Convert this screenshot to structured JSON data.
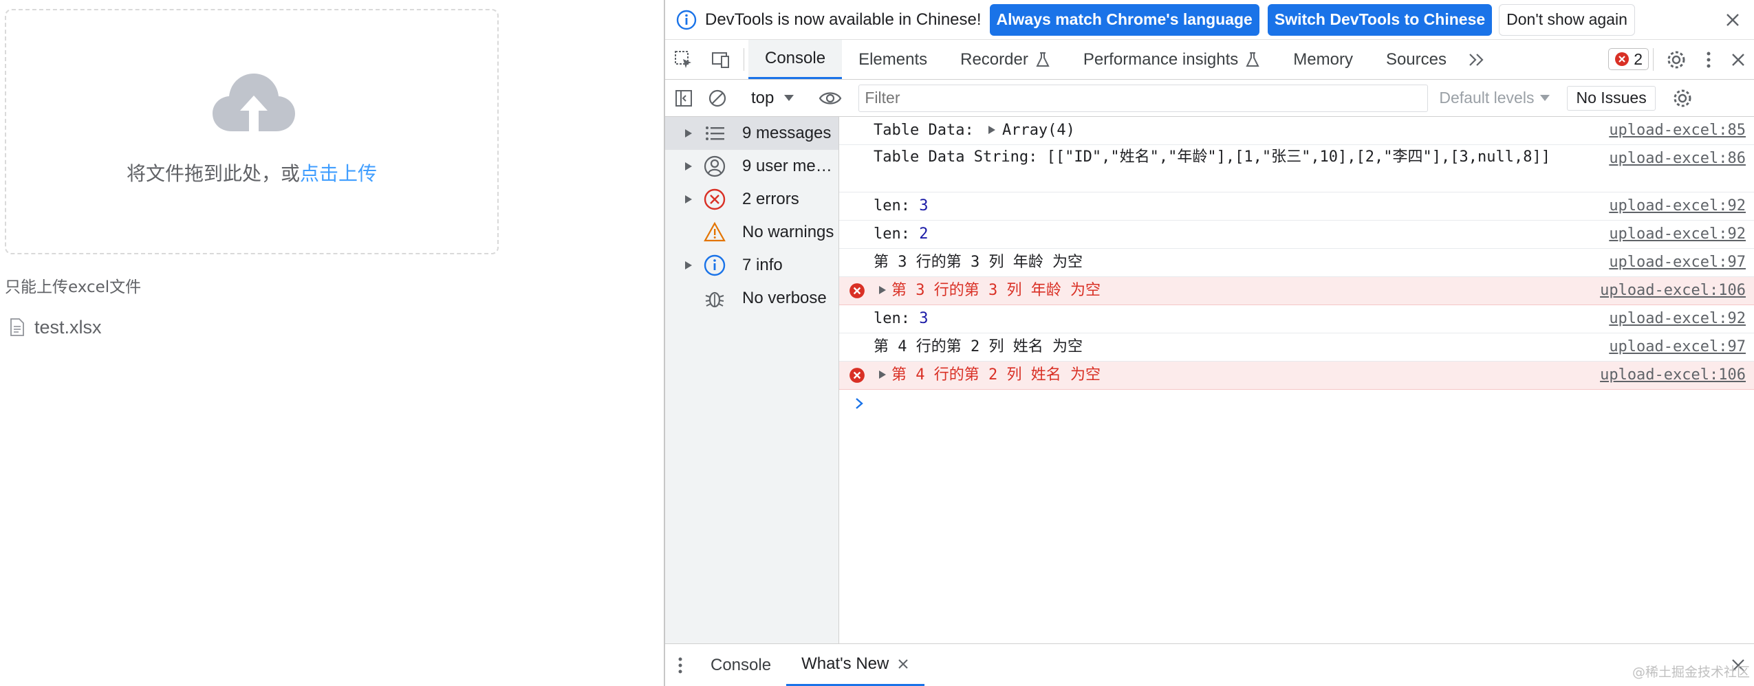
{
  "upload": {
    "drop_text": "将文件拖到此处，或",
    "click_upload": "点击上传",
    "tip": "只能上传excel文件",
    "file_name": "test.xlsx"
  },
  "devtools": {
    "infobar": {
      "message": "DevTools is now available in Chinese!",
      "btn_match": "Always match Chrome's language",
      "btn_switch": "Switch DevTools to Chinese",
      "btn_dismiss": "Don't show again"
    },
    "tabs": [
      "Console",
      "Elements",
      "Recorder",
      "Performance insights",
      "Memory",
      "Sources"
    ],
    "error_count": "2",
    "toolbar": {
      "context": "top",
      "filter_placeholder": "Filter",
      "levels": "Default levels",
      "issues": "No Issues"
    },
    "sidebar": [
      {
        "label": "9 messages",
        "icon": "list-icon"
      },
      {
        "label": "9 user me…",
        "icon": "user-icon"
      },
      {
        "label": "2 errors",
        "icon": "error-icon"
      },
      {
        "label": "No warnings",
        "icon": "warning-icon"
      },
      {
        "label": "7 info",
        "icon": "info-icon"
      },
      {
        "label": "No verbose",
        "icon": "bug-icon"
      }
    ],
    "console": [
      {
        "prefix": "Table Data: ",
        "text": "Array(4)",
        "source": "upload-excel:85"
      },
      {
        "text": "Table Data String: [[\"ID\",\"姓名\",\"年龄\"],[1,\"张三\",10],[2,\"李四\"],[3,null,8]]",
        "source": "upload-excel:86"
      },
      {
        "prefix": "len: ",
        "text": "3",
        "source": "upload-excel:92"
      },
      {
        "prefix": "len: ",
        "text": "2",
        "source": "upload-excel:92"
      },
      {
        "text": "第 3 行的第 3 列 年龄 为空",
        "source": "upload-excel:97"
      },
      {
        "text": "第 3 行的第 3 列 年龄 为空",
        "source": "upload-excel:106"
      },
      {
        "prefix": "len: ",
        "text": "3",
        "source": "upload-excel:92"
      },
      {
        "text": "第 4 行的第 2 列 姓名 为空",
        "source": "upload-excel:97"
      },
      {
        "text": "第 4 行的第 2 列 姓名 为空",
        "source": "upload-excel:106"
      }
    ],
    "drawer_tabs": [
      "Console",
      "What's New"
    ]
  },
  "watermark": "@稀土掘金技术社区",
  "colors": {
    "accent": "#1a73e8",
    "error": "#d93025",
    "link": "#409eff"
  }
}
